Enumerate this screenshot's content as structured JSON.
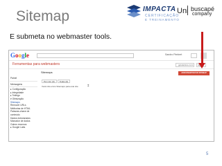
{
  "slide": {
    "title": "Sitemap",
    "subtitle": "E submeta no webmaster tools.",
    "page_number": "5",
    "logos": {
      "impacta": "IMPACTA",
      "impacta_sub1": "CERTIFICAÇÃO",
      "impacta_sub2": "E TREINAMENTO",
      "uni": "Uni",
      "buscape": "buscapé",
      "buscape_sub": "company"
    }
  },
  "screenshot": {
    "google_logo": "Google",
    "user": "Sandro Pimbert",
    "webmaster_title": "Ferramentas para webmasters",
    "site_select": "gotolecture.com",
    "help": "Ajuda",
    "add_sitemap_button": "ADICIONAR/TESTAR SITEMAP",
    "main_heading": "Sitemaps",
    "tabs": [
      "Por mim (0)",
      "Todos (0)"
    ],
    "empty_message": "Você não envio Sitemaps para este site",
    "sidebar": [
      {
        "label": "Painel",
        "type": "item"
      },
      {
        "label": "Mensagens",
        "type": "head"
      },
      {
        "label": "▸ Configuração",
        "type": "item"
      },
      {
        "label": "▸ Integridade",
        "type": "item"
      },
      {
        "label": "▸ Tráfego",
        "type": "item"
      },
      {
        "label": "▾ Otimização",
        "type": "item"
      },
      {
        "label": "Sitemaps",
        "type": "link"
      },
      {
        "label": "Remover URLs",
        "type": "item"
      },
      {
        "label": "Melhorias de HTML",
        "type": "item"
      },
      {
        "label": "Palavras-chave de",
        "type": "item"
      },
      {
        "label": "conteúdo",
        "type": "item"
      },
      {
        "label": "Dados estruturados",
        "type": "item"
      },
      {
        "label": "Marcador de dados",
        "type": "item"
      },
      {
        "label": "Outros recursos",
        "type": "item"
      },
      {
        "label": "▸ Google Labs",
        "type": "item"
      }
    ]
  },
  "colors": {
    "arrow": "#c81c1c",
    "title": "#7a7a7a",
    "button": "#d14836"
  }
}
